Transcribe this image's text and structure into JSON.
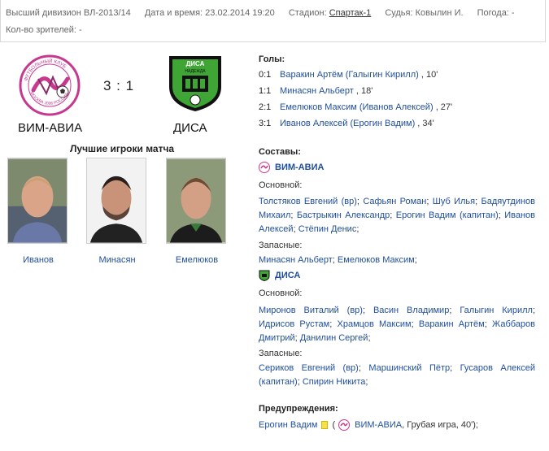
{
  "header": {
    "division": "Высший дивизион ВЛ-2013/14",
    "datetime": "Дата и время: 23.02.2014 19:20",
    "stadium_label": "Стадион:",
    "stadium": "Спартак-1",
    "referee": "Судья: Ковылин И.",
    "weather": "Погода: -",
    "spectators": "Кол-во зрителей: -"
  },
  "match": {
    "home_team": "ВИМ-АВИА",
    "away_team": "ДИСА",
    "score": "3 : 1",
    "home_logo_text": "ФУТБОЛЬНЫЙ КЛУБ",
    "home_logo_sub": "МОСКВА 2006 РОССИЯ",
    "away_logo_text": "ДИСА",
    "away_logo_sub": "НАДЕЖДА"
  },
  "best_players": {
    "title": "Лучшие игроки матча",
    "players": [
      {
        "name": "Иванов"
      },
      {
        "name": "Минасян"
      },
      {
        "name": "Емелюков"
      }
    ]
  },
  "goals": {
    "title": "Голы:",
    "items": [
      {
        "score": "0:1",
        "player": "Варакин Артём (Галыгин Кирилл)",
        "minute": ", 10'"
      },
      {
        "score": "1:1",
        "player": "Минасян Альберт",
        "minute": ", 18'"
      },
      {
        "score": "2:1",
        "player": "Емелюков Максим (Иванов Алексей)",
        "minute": ", 27'"
      },
      {
        "score": "3:1",
        "player": "Иванов Алексей (Ерогин Вадим)",
        "minute": ", 34'"
      }
    ]
  },
  "lineups": {
    "title": "Составы:",
    "main_label": "Основной:",
    "subs_label": "Запасные:",
    "home": {
      "name": "ВИМ-АВИА",
      "main": [
        "Толстяков Евгений (вр)",
        "Сафьян Роман",
        "Шуб Илья",
        "Бадяутдинов Михаил",
        "Бастрыкин Александр",
        "Ерогин Вадим (капитан)",
        "Иванов Алексей",
        "Стёпин Денис"
      ],
      "subs": [
        "Минасян Альберт",
        "Емелюков Максим"
      ]
    },
    "away": {
      "name": "ДИСА",
      "main": [
        "Миронов Виталий (вр)",
        "Васин Владимир",
        "Галыгин Кирилл",
        "Идрисов Рустам",
        "Храмцов Максим",
        "Варакин Артём",
        "Жаббаров Дмитрий",
        "Данилин Сергей"
      ],
      "subs": [
        "Сериков Евгений (вр)",
        "Маршинский Пётр",
        "Гусаров Алексей (капитан)",
        "Спирин Никита"
      ]
    }
  },
  "warnings": {
    "title": "Предупреждения:",
    "player": "Ерогин Вадим",
    "open_paren": "(",
    "team": "ВИМ-АВИА",
    "reason": ", Грубая игра, 40');"
  },
  "colors": {
    "link": "#1f4e9c",
    "home_accent": "#c7398f",
    "away_green": "#3fa535",
    "yellow_card": "#f5e04a"
  }
}
